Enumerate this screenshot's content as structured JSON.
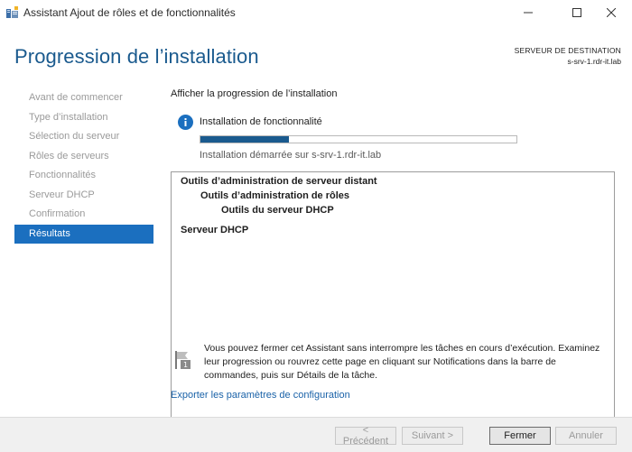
{
  "window": {
    "title": "Assistant Ajout de rôles et de fonctionnalités",
    "app_icon": "server-manager-icon",
    "controls": {
      "minimize": "minimize-icon",
      "maximize": "maximize-icon",
      "close": "close-icon"
    }
  },
  "header": {
    "title": "Progression de l’installation",
    "destination_label": "SERVEUR DE DESTINATION",
    "destination_server": "s-srv-1.rdr-it.lab"
  },
  "sidebar": {
    "items": [
      {
        "label": "Avant de commencer",
        "active": false
      },
      {
        "label": "Type d’installation",
        "active": false
      },
      {
        "label": "Sélection du serveur",
        "active": false
      },
      {
        "label": "Rôles de serveurs",
        "active": false
      },
      {
        "label": "Fonctionnalités",
        "active": false
      },
      {
        "label": "Serveur DHCP",
        "active": false
      },
      {
        "label": "Confirmation",
        "active": false
      },
      {
        "label": "Résultats",
        "active": true
      }
    ]
  },
  "main": {
    "heading": "Afficher la progression de l’installation",
    "progress": {
      "icon": "info-icon",
      "label": "Installation de fonctionnalité",
      "percent": 28,
      "status": "Installation démarrée sur s-srv-1.rdr-it.lab"
    },
    "results": [
      {
        "text": "Outils d’administration de serveur distant",
        "indent": 0
      },
      {
        "text": "Outils d’administration de rôles",
        "indent": 1
      },
      {
        "text": "Outils du serveur DHCP",
        "indent": 2
      },
      {
        "text": "Serveur DHCP",
        "indent": 0
      }
    ],
    "note": {
      "icon": "notification-flag-icon",
      "text": "Vous pouvez fermer cet Assistant sans interrompre les tâches en cours d’exécution. Examinez leur progression ou rouvrez cette page en cliquant sur Notifications dans la barre de commandes, puis sur Détails de la tâche."
    },
    "export_link": "Exporter les paramètres de configuration"
  },
  "footer": {
    "previous": "< Précédent",
    "next": "Suivant >",
    "close": "Fermer",
    "cancel": "Annuler"
  },
  "colors": {
    "accent": "#1b6fbf",
    "title": "#1a5a8e",
    "progress": "#1a5a8e",
    "link": "#1a62a8"
  }
}
